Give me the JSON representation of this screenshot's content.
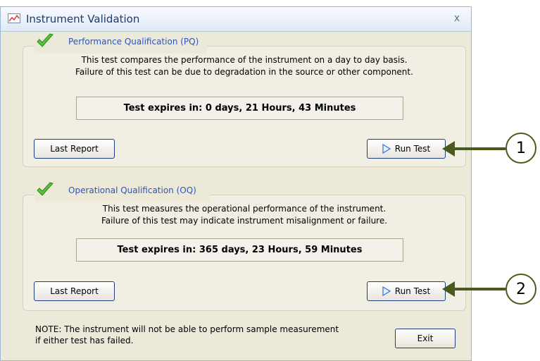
{
  "window": {
    "title": "Instrument Validation",
    "close_glyph": "x",
    "icon": "chart-icon"
  },
  "pq": {
    "title": "Performance Qualification  (PQ)",
    "desc1": "This test compares the performance of the instrument on a day to day basis.",
    "desc2": "Failure of this test can be due to degradation in the source or other component.",
    "expires": "Test expires in: 0 days, 21 Hours, 43 Minutes",
    "last_report": "Last Report",
    "run_test": "Run Test"
  },
  "oq": {
    "title": "Operational Qualification  (OQ)",
    "desc1": "This test measures the operational performance of the instrument.",
    "desc2": "Failure of this test may indicate instrument misalignment or failure.",
    "expires": "Test expires in: 365 days, 23 Hours, 59 Minutes",
    "last_report": "Last Report",
    "run_test": "Run Test"
  },
  "footer": {
    "note1": "NOTE:  The instrument will not be able to perform sample measurement",
    "note2": "if either test has failed.",
    "exit": "Exit"
  },
  "callouts": {
    "one": "1",
    "two": "2"
  },
  "colors": {
    "check": "#58c23a",
    "title_blue": "#2d55b8",
    "callout": "#4a5a1d"
  }
}
